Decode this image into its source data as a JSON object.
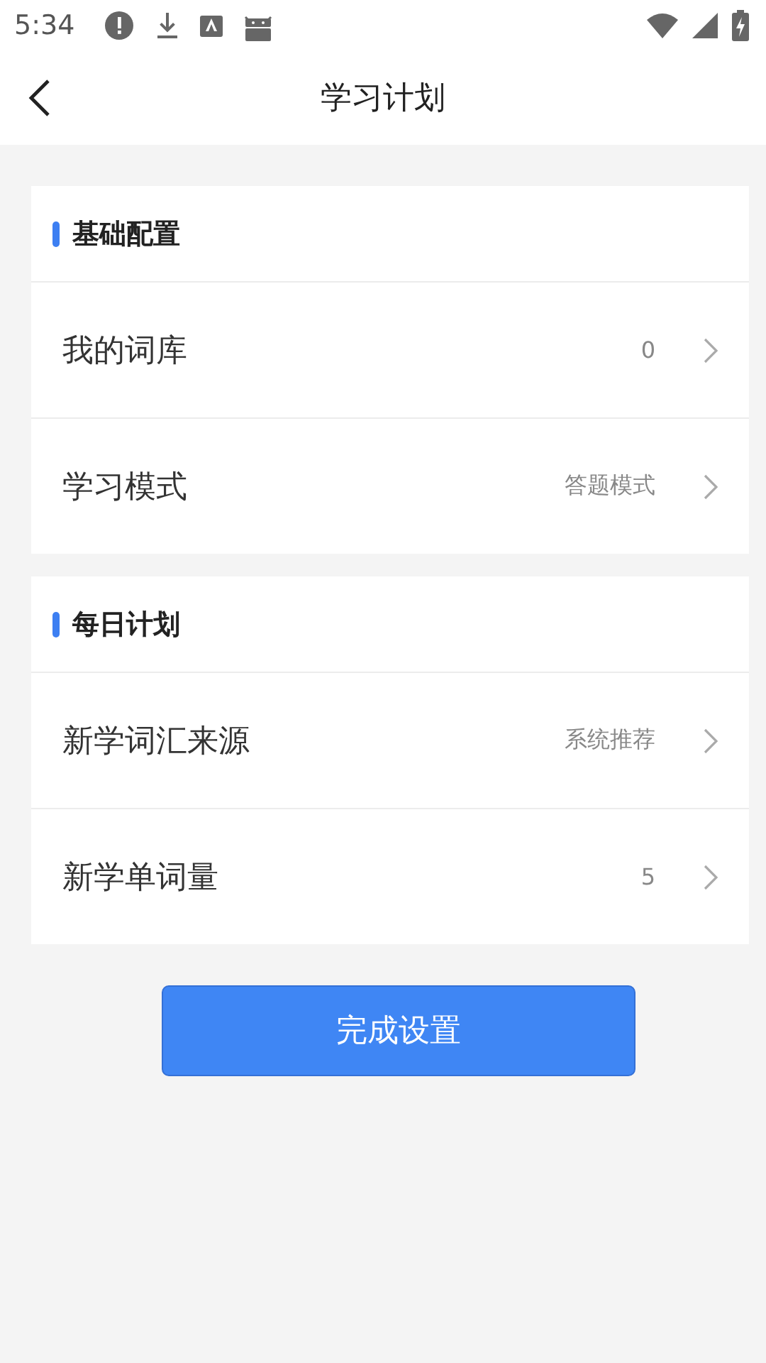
{
  "status_bar": {
    "time": "5:34"
  },
  "header": {
    "title": "学习计划"
  },
  "sections": [
    {
      "title": "基础配置",
      "rows": [
        {
          "label": "我的词库",
          "value": "0"
        },
        {
          "label": "学习模式",
          "value": "答题模式"
        }
      ]
    },
    {
      "title": "每日计划",
      "rows": [
        {
          "label": "新学词汇来源",
          "value": "系统推荐"
        },
        {
          "label": "新学单词量",
          "value": "5"
        }
      ]
    }
  ],
  "button": {
    "label": "完成设置"
  }
}
